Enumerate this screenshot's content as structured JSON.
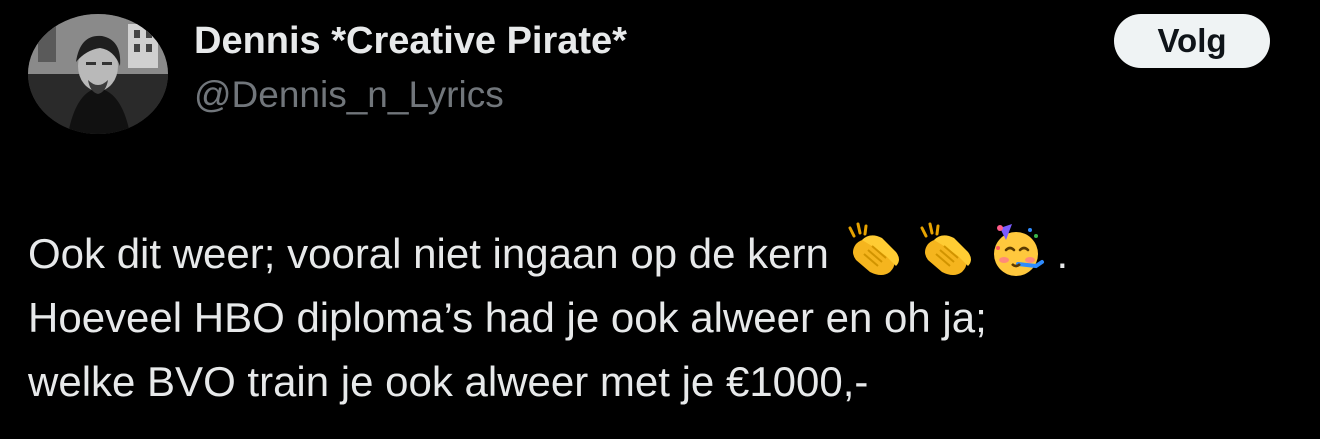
{
  "author": {
    "display_name": "Dennis *Creative Pirate*",
    "handle": "@Dennis_n_Lyrics",
    "avatar": "profile-photo"
  },
  "follow_button": {
    "label": "Volg"
  },
  "tweet": {
    "line1_text": "Ook dit weer; vooral niet ingaan op de kern",
    "line1_emojis": [
      "clapping-hands-emoji",
      "clapping-hands-emoji",
      "partying-face-emoji"
    ],
    "line1_end": ".",
    "line2": "Hoeveel HBO diploma’s had je ook alweer en oh ja;",
    "line3": "welke BVO train je ook alweer met je €1000,-"
  }
}
